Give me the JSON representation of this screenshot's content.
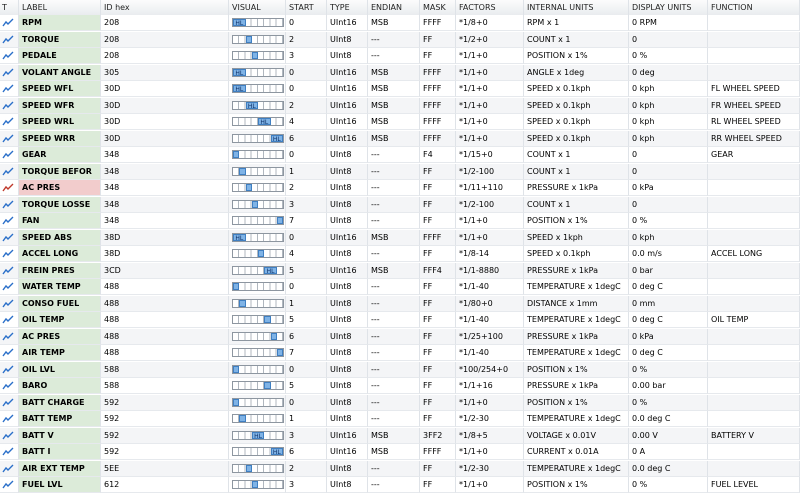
{
  "columns": [
    "T",
    "LABEL",
    "ID hex",
    "VISUAL",
    "START",
    "TYPE",
    "ENDIAN",
    "MASK",
    "FACTORS",
    "INTERNAL UNITS",
    "DISPLAY UNITS",
    "FUNCTION"
  ],
  "rows": [
    {
      "label": "RPM",
      "id": "208",
      "hl": "HL",
      "start": "0",
      "type": "UInt16",
      "endian": "MSB",
      "mask": "FFFF",
      "factors": "*1/8+0",
      "internal": "RPM x 1",
      "display": "0 RPM",
      "function": ""
    },
    {
      "label": "TORQUE",
      "id": "208",
      "hl": "",
      "start": "2",
      "type": "UInt8",
      "endian": "---",
      "mask": "FF",
      "factors": "*1/2+0",
      "internal": "COUNT x 1",
      "display": "0",
      "function": ""
    },
    {
      "label": "PEDALE",
      "id": "208",
      "hl": "",
      "start": "3",
      "type": "UInt8",
      "endian": "---",
      "mask": "FF",
      "factors": "*1/1+0",
      "internal": "POSITION x 1%",
      "display": "0 %",
      "function": ""
    },
    {
      "label": "VOLANT ANGLE",
      "id": "305",
      "hl": "HL",
      "start": "0",
      "type": "UInt16",
      "endian": "MSB",
      "mask": "FFFF",
      "factors": "*1/1+0",
      "internal": "ANGLE x 1deg",
      "display": "0 deg",
      "function": ""
    },
    {
      "label": "SPEED WFL",
      "id": "30D",
      "hl": "HL",
      "start": "0",
      "type": "UInt16",
      "endian": "MSB",
      "mask": "FFFF",
      "factors": "*1/1+0",
      "internal": "SPEED x 0.1kph",
      "display": "0 kph",
      "function": "FL WHEEL SPEED"
    },
    {
      "label": "SPEED WFR",
      "id": "30D",
      "hl": "HL",
      "start": "2",
      "type": "UInt16",
      "endian": "MSB",
      "mask": "FFFF",
      "factors": "*1/1+0",
      "internal": "SPEED x 0.1kph",
      "display": "0 kph",
      "function": "FR WHEEL SPEED"
    },
    {
      "label": "SPEED WRL",
      "id": "30D",
      "hl": "HL",
      "start": "4",
      "type": "UInt16",
      "endian": "MSB",
      "mask": "FFFF",
      "factors": "*1/1+0",
      "internal": "SPEED x 0.1kph",
      "display": "0 kph",
      "function": "RL WHEEL SPEED"
    },
    {
      "label": "SPEED WRR",
      "id": "30D",
      "hl": "HL",
      "start": "6",
      "type": "UInt16",
      "endian": "MSB",
      "mask": "FFFF",
      "factors": "*1/1+0",
      "internal": "SPEED x 0.1kph",
      "display": "0 kph",
      "function": "RR WHEEL SPEED"
    },
    {
      "label": "GEAR",
      "id": "348",
      "hl": "",
      "start": "0",
      "type": "UInt8",
      "endian": "---",
      "mask": "F4",
      "factors": "*1/15+0",
      "internal": "COUNT x 1",
      "display": "0",
      "function": "GEAR"
    },
    {
      "label": "TORQUE BEFOR",
      "id": "348",
      "hl": "",
      "start": "1",
      "type": "UInt8",
      "endian": "---",
      "mask": "FF",
      "factors": "*1/2-100",
      "internal": "COUNT x 1",
      "display": "0",
      "function": ""
    },
    {
      "label": "AC PRES",
      "id": "348",
      "hl": "",
      "start": "2",
      "type": "UInt8",
      "endian": "---",
      "mask": "FF",
      "factors": "*1/11+110",
      "internal": "PRESSURE x 1kPa",
      "display": "0 kPa",
      "function": ""
    },
    {
      "label": "TORQUE LOSSE",
      "id": "348",
      "hl": "",
      "start": "3",
      "type": "UInt8",
      "endian": "---",
      "mask": "FF",
      "factors": "*1/2-100",
      "internal": "COUNT x 1",
      "display": "0",
      "function": ""
    },
    {
      "label": "FAN",
      "id": "348",
      "hl": "",
      "start": "7",
      "type": "UInt8",
      "endian": "---",
      "mask": "FF",
      "factors": "*1/1+0",
      "internal": "POSITION x 1%",
      "display": "0 %",
      "function": ""
    },
    {
      "label": "SPEED ABS",
      "id": "38D",
      "hl": "HL",
      "start": "0",
      "type": "UInt16",
      "endian": "MSB",
      "mask": "FFFF",
      "factors": "*1/1+0",
      "internal": "SPEED x 1kph",
      "display": "0 kph",
      "function": ""
    },
    {
      "label": "ACCEL LONG",
      "id": "38D",
      "hl": "",
      "start": "4",
      "type": "UInt8",
      "endian": "---",
      "mask": "FF",
      "factors": "*1/8-14",
      "internal": "SPEED x 0.1kph",
      "display": "0.0 m/s",
      "function": "ACCEL LONG"
    },
    {
      "label": "FREIN PRES",
      "id": "3CD",
      "hl": "HL",
      "start": "5",
      "type": "UInt16",
      "endian": "MSB",
      "mask": "FFF4",
      "factors": "*1/1-8880",
      "internal": "PRESSURE x 1kPa",
      "display": "0 bar",
      "function": ""
    },
    {
      "label": "WATER TEMP",
      "id": "488",
      "hl": "",
      "start": "0",
      "type": "UInt8",
      "endian": "---",
      "mask": "FF",
      "factors": "*1/1-40",
      "internal": "TEMPERATURE x 1degC",
      "display": "0 deg C",
      "function": ""
    },
    {
      "label": "CONSO FUEL",
      "id": "488",
      "hl": "",
      "start": "1",
      "type": "UInt8",
      "endian": "---",
      "mask": "FF",
      "factors": "*1/80+0",
      "internal": "DISTANCE x 1mm",
      "display": "0 mm",
      "function": ""
    },
    {
      "label": "OIL TEMP",
      "id": "488",
      "hl": "",
      "start": "5",
      "type": "UInt8",
      "endian": "---",
      "mask": "FF",
      "factors": "*1/1-40",
      "internal": "TEMPERATURE x 1degC",
      "display": "0 deg C",
      "function": "OIL TEMP"
    },
    {
      "label": "AC PRES",
      "id": "488",
      "hl": "",
      "start": "6",
      "type": "UInt8",
      "endian": "---",
      "mask": "FF",
      "factors": "*1/25+100",
      "internal": "PRESSURE x 1kPa",
      "display": "0 kPa",
      "function": ""
    },
    {
      "label": "AIR TEMP",
      "id": "488",
      "hl": "",
      "start": "7",
      "type": "UInt8",
      "endian": "---",
      "mask": "FF",
      "factors": "*1/1-40",
      "internal": "TEMPERATURE x 1degC",
      "display": "0 deg C",
      "function": ""
    },
    {
      "label": "OIL LVL",
      "id": "588",
      "hl": "",
      "start": "0",
      "type": "UInt8",
      "endian": "---",
      "mask": "FF",
      "factors": "*100/254+0",
      "internal": "POSITION x 1%",
      "display": "0 %",
      "function": ""
    },
    {
      "label": "BARO",
      "id": "588",
      "hl": "",
      "start": "5",
      "type": "UInt8",
      "endian": "---",
      "mask": "FF",
      "factors": "*1/1+16",
      "internal": "PRESSURE x 1kPa",
      "display": "0.00 bar",
      "function": ""
    },
    {
      "label": "BATT CHARGE",
      "id": "592",
      "hl": "",
      "start": "0",
      "type": "UInt8",
      "endian": "---",
      "mask": "FF",
      "factors": "*1/1+0",
      "internal": "POSITION x 1%",
      "display": "0 %",
      "function": ""
    },
    {
      "label": "BATT TEMP",
      "id": "592",
      "hl": "",
      "start": "1",
      "type": "UInt8",
      "endian": "---",
      "mask": "FF",
      "factors": "*1/2-30",
      "internal": "TEMPERATURE x 1degC",
      "display": "0.0 deg C",
      "function": ""
    },
    {
      "label": "BATT V",
      "id": "592",
      "hl": "HL",
      "start": "3",
      "type": "UInt16",
      "endian": "MSB",
      "mask": "3FF2",
      "factors": "*1/8+5",
      "internal": "VOLTAGE x 0.01V",
      "display": "0.00 V",
      "function": "BATTERY V"
    },
    {
      "label": "BATT I",
      "id": "592",
      "hl": "HL",
      "start": "6",
      "type": "UInt16",
      "endian": "MSB",
      "mask": "FFFF",
      "factors": "*1/1+0",
      "internal": "CURRENT x 0.01A",
      "display": "0 A",
      "function": ""
    },
    {
      "label": "AIR EXT TEMP",
      "id": "5EE",
      "hl": "",
      "start": "2",
      "type": "UInt8",
      "endian": "---",
      "mask": "FF",
      "factors": "*1/2-30",
      "internal": "TEMPERATURE x 1degC",
      "display": "0.0 deg C",
      "function": ""
    },
    {
      "label": "FUEL LVL",
      "id": "612",
      "hl": "",
      "start": "3",
      "type": "UInt8",
      "endian": "---",
      "mask": "FF",
      "factors": "*1/1+0",
      "internal": "POSITION x 1%",
      "display": "0 %",
      "function": "FUEL LEVEL"
    }
  ],
  "alert_label_color": "#f2cccc",
  "label_color": "#dcebd9",
  "icon": "trend-chart-icon"
}
